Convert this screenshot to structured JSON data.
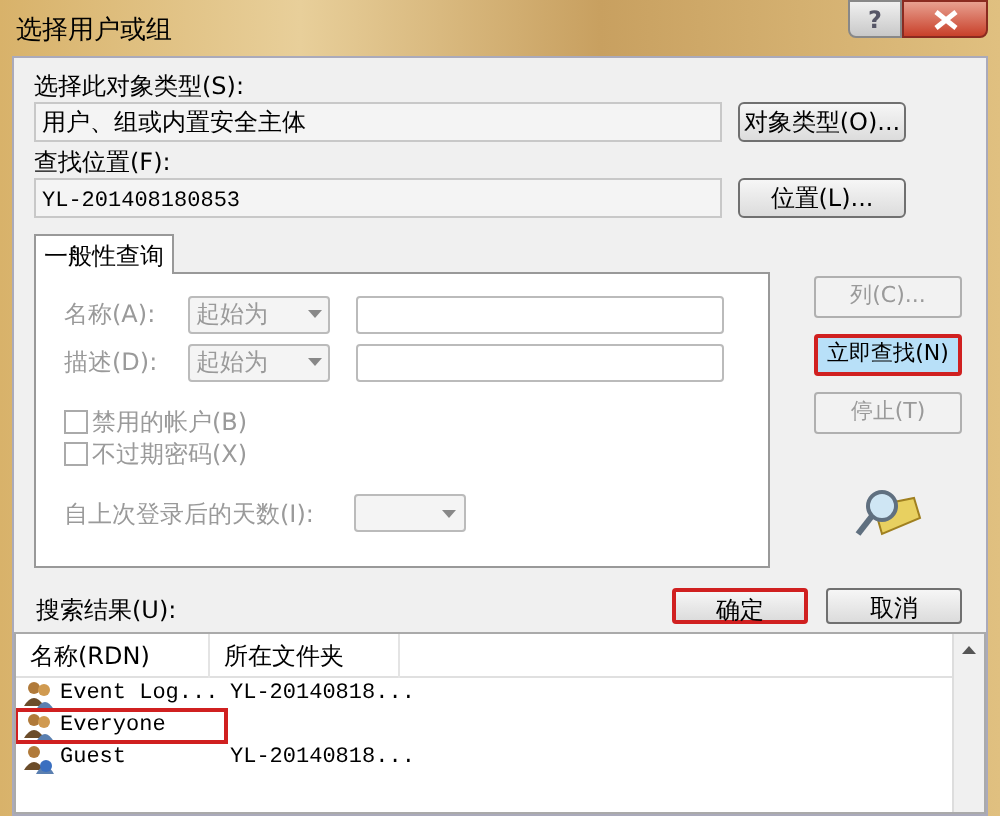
{
  "window": {
    "title": "选择用户或组",
    "help": "?"
  },
  "object_type": {
    "label": "选择此对象类型(S):",
    "value": "用户、组或内置安全主体",
    "button": "对象类型(O)..."
  },
  "location": {
    "label": "查找位置(F):",
    "value": "YL-201408180853",
    "button": "位置(L)..."
  },
  "tabs": [
    {
      "label": "一般性查询",
      "selected": true
    }
  ],
  "query": {
    "disabled": true,
    "rows": [
      {
        "label": "名称(A):",
        "match": "起始为"
      },
      {
        "label": "描述(D):",
        "match": "起始为"
      }
    ],
    "checkboxes": [
      {
        "label": "禁用的帐户(B)",
        "checked": false
      },
      {
        "label": "不过期密码(X)",
        "checked": false
      }
    ],
    "days": {
      "label": "自上次登录后的天数(I):"
    }
  },
  "side_buttons": [
    {
      "label": "列(C)...",
      "disabled": true,
      "highlighted": false
    },
    {
      "label": "立即查找(N)",
      "disabled": false,
      "highlighted": true
    },
    {
      "label": "停止(T)",
      "disabled": true,
      "highlighted": false
    }
  ],
  "dialog_buttons": [
    {
      "label": "确定",
      "highlighted": true
    },
    {
      "label": "取消",
      "highlighted": false
    }
  ],
  "results": {
    "label": "搜索结果(U):",
    "columns": [
      "名称(RDN)",
      "所在文件夹"
    ],
    "rows": [
      {
        "name": "Event Log...",
        "folder": "YL-20140818...",
        "kind": "group",
        "highlighted": false
      },
      {
        "name": "Everyone",
        "kind": "group",
        "highlighted": true
      },
      {
        "name": "Guest",
        "folder": "YL-20140818...",
        "kind": "user",
        "highlighted": false
      }
    ]
  }
}
